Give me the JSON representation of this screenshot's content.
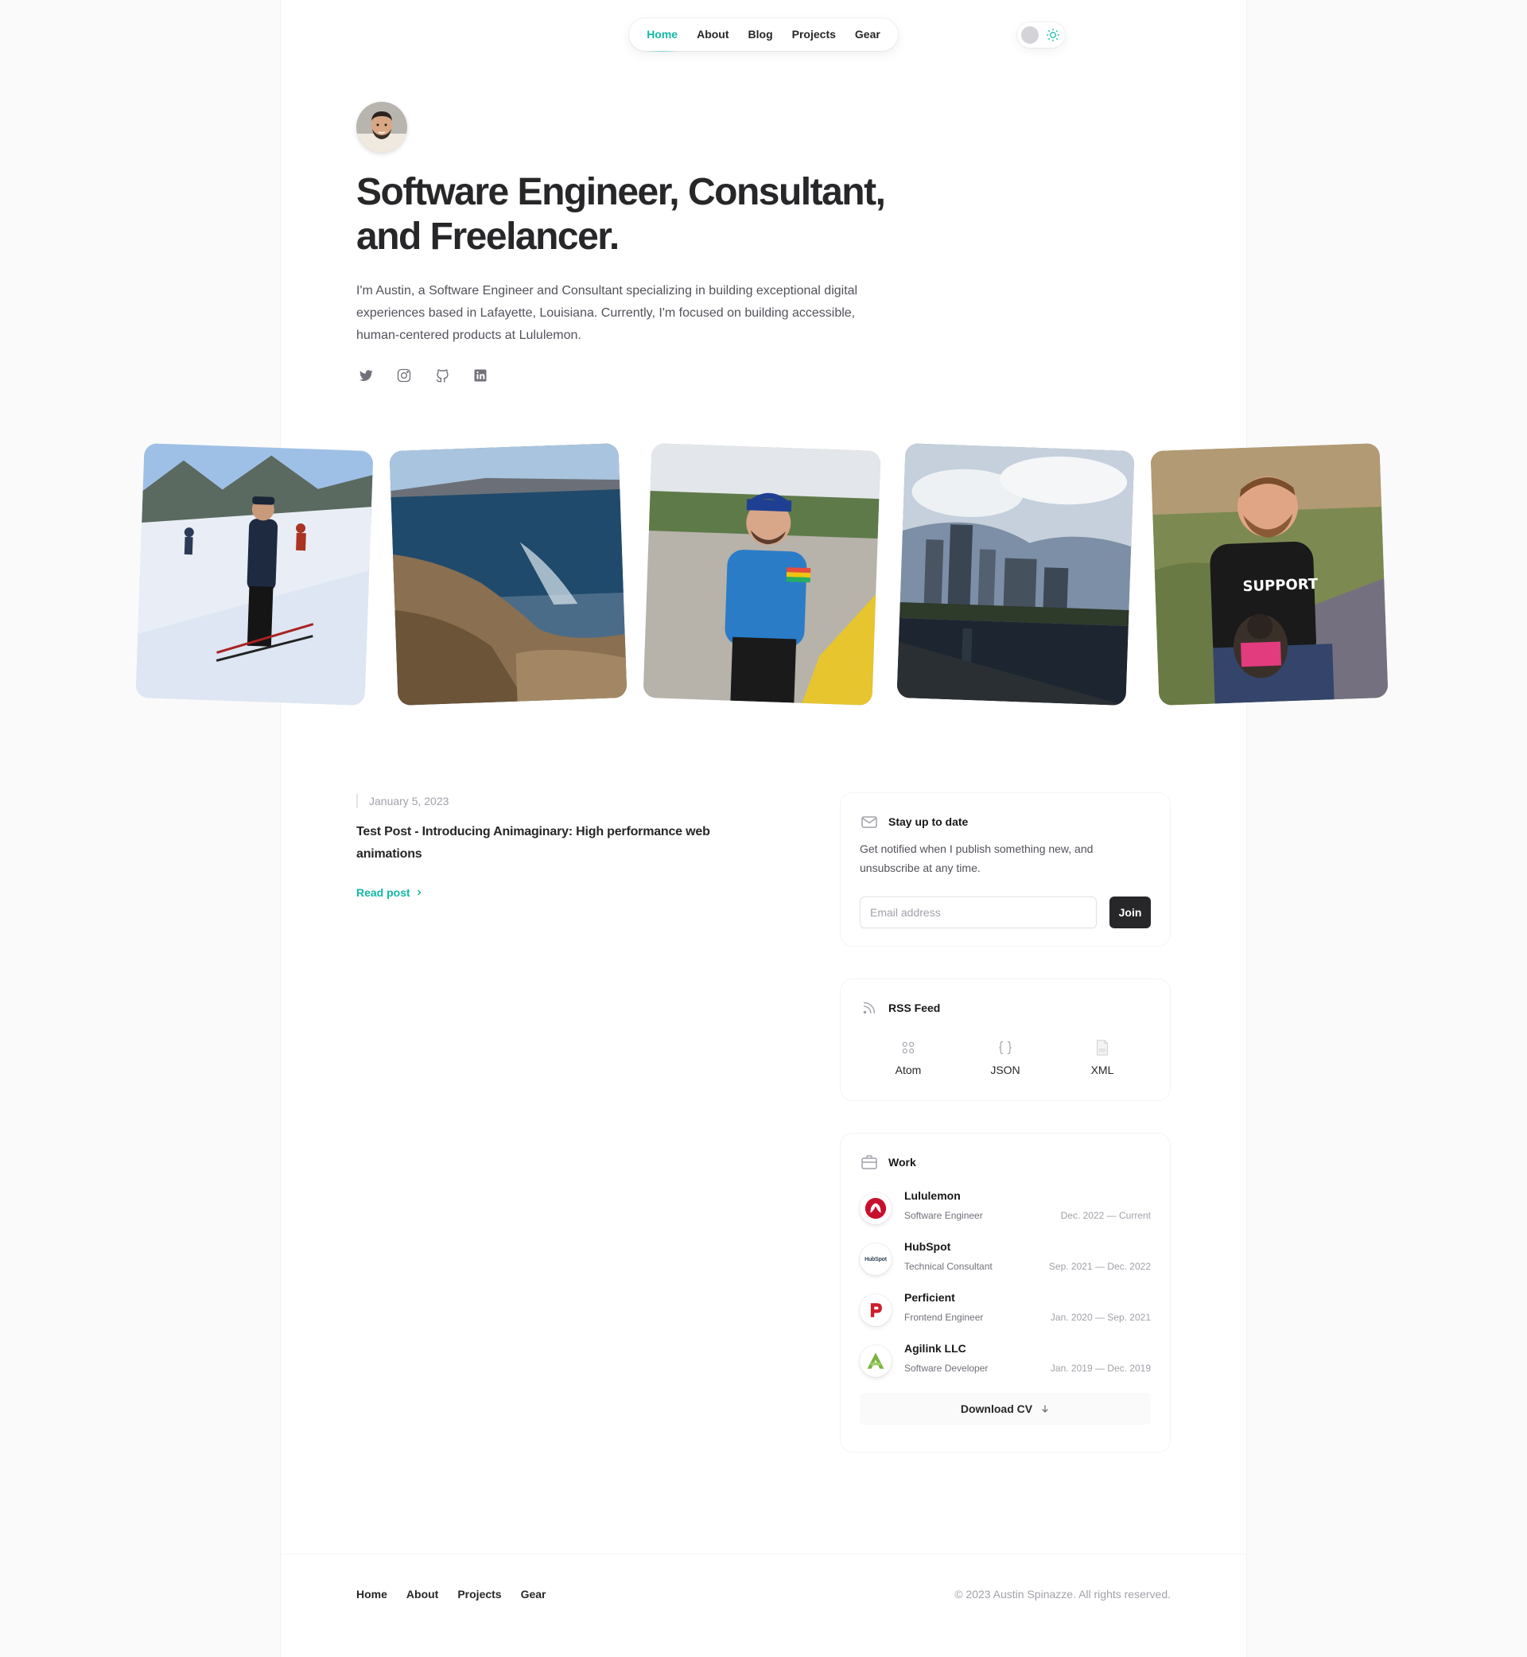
{
  "nav": {
    "items": [
      {
        "label": "Home",
        "active": true
      },
      {
        "label": "About"
      },
      {
        "label": "Blog"
      },
      {
        "label": "Projects"
      },
      {
        "label": "Gear"
      }
    ]
  },
  "theme_toggle": {
    "icon": "sun-icon"
  },
  "hero": {
    "title_line1": "Software Engineer, Consultant,",
    "title_line2": "and Freelancer.",
    "description": "I'm Austin, a Software Engineer and Consultant specializing in building exceptional digital experiences based in Lafayette, Louisiana. Currently, I'm focused on building accessible, human-centered products at Lululemon.",
    "socials": [
      "twitter-icon",
      "instagram-icon",
      "github-icon",
      "linkedin-icon"
    ]
  },
  "photos": [
    {
      "subject": "skiing"
    },
    {
      "subject": "coastal cliffs"
    },
    {
      "subject": "man in blue hoodie"
    },
    {
      "subject": "city skyline over river"
    },
    {
      "subject": "man with dog"
    }
  ],
  "article": {
    "date": "January 5, 2023",
    "title": "Test Post - Introducing Animaginary: High performance web animations",
    "link": "Read post"
  },
  "newsletter": {
    "title": "Stay up to date",
    "description": "Get notified when I publish something new, and unsubscribe at any time.",
    "placeholder": "Email address",
    "button": "Join"
  },
  "rss": {
    "title": "RSS Feed",
    "items": [
      {
        "label": "Atom"
      },
      {
        "label": "JSON"
      },
      {
        "label": "XML"
      }
    ]
  },
  "work": {
    "title": "Work",
    "items": [
      {
        "company": "Lululemon",
        "role": "Software Engineer",
        "dates": "Dec. 2022 — Current"
      },
      {
        "company": "HubSpot",
        "role": "Technical Consultant",
        "dates": "Sep. 2021 — Dec. 2022",
        "logo_text": "HubSpot"
      },
      {
        "company": "Perficient",
        "role": "Frontend Engineer",
        "dates": "Jan. 2020 — Sep. 2021"
      },
      {
        "company": "Agilink LLC",
        "role": "Software Developer",
        "dates": "Jan. 2019 — Dec. 2019"
      }
    ],
    "download": "Download CV"
  },
  "footer": {
    "links": [
      "Home",
      "About",
      "Projects",
      "Gear"
    ],
    "copyright": "© 2023 Austin Spinazze. All rights reserved."
  },
  "colors": {
    "accent": "#14b8a6",
    "text": "#27272a",
    "muted": "#a1a1aa"
  }
}
